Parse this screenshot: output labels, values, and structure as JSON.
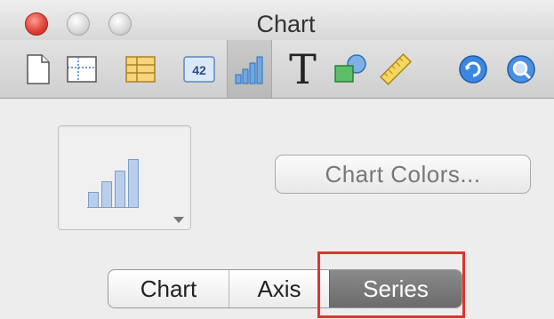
{
  "window": {
    "title": "Chart"
  },
  "toolbar": {
    "items": [
      {
        "icon": "document-icon"
      },
      {
        "icon": "layout-icon"
      },
      {
        "icon": "table-icon"
      },
      {
        "icon": "number-icon",
        "label": "42"
      },
      {
        "icon": "bar-chart-icon",
        "selected": true
      },
      {
        "icon": "text-icon",
        "label": "T"
      },
      {
        "icon": "shapes-icon"
      },
      {
        "icon": "ruler-icon"
      },
      {
        "icon": "quicktime-icon"
      },
      {
        "icon": "search-icon"
      }
    ]
  },
  "chart_panel": {
    "chart_colors_label": "Chart Colors..."
  },
  "tabs": [
    {
      "label": "Chart",
      "selected": false
    },
    {
      "label": "Axis",
      "selected": false
    },
    {
      "label": "Series",
      "selected": true
    }
  ],
  "colors": {
    "highlight": "#e0332f",
    "selected_tab": "#777777",
    "bar_fill": "#b9cfe9",
    "bar_stroke": "#7e9ec8"
  }
}
